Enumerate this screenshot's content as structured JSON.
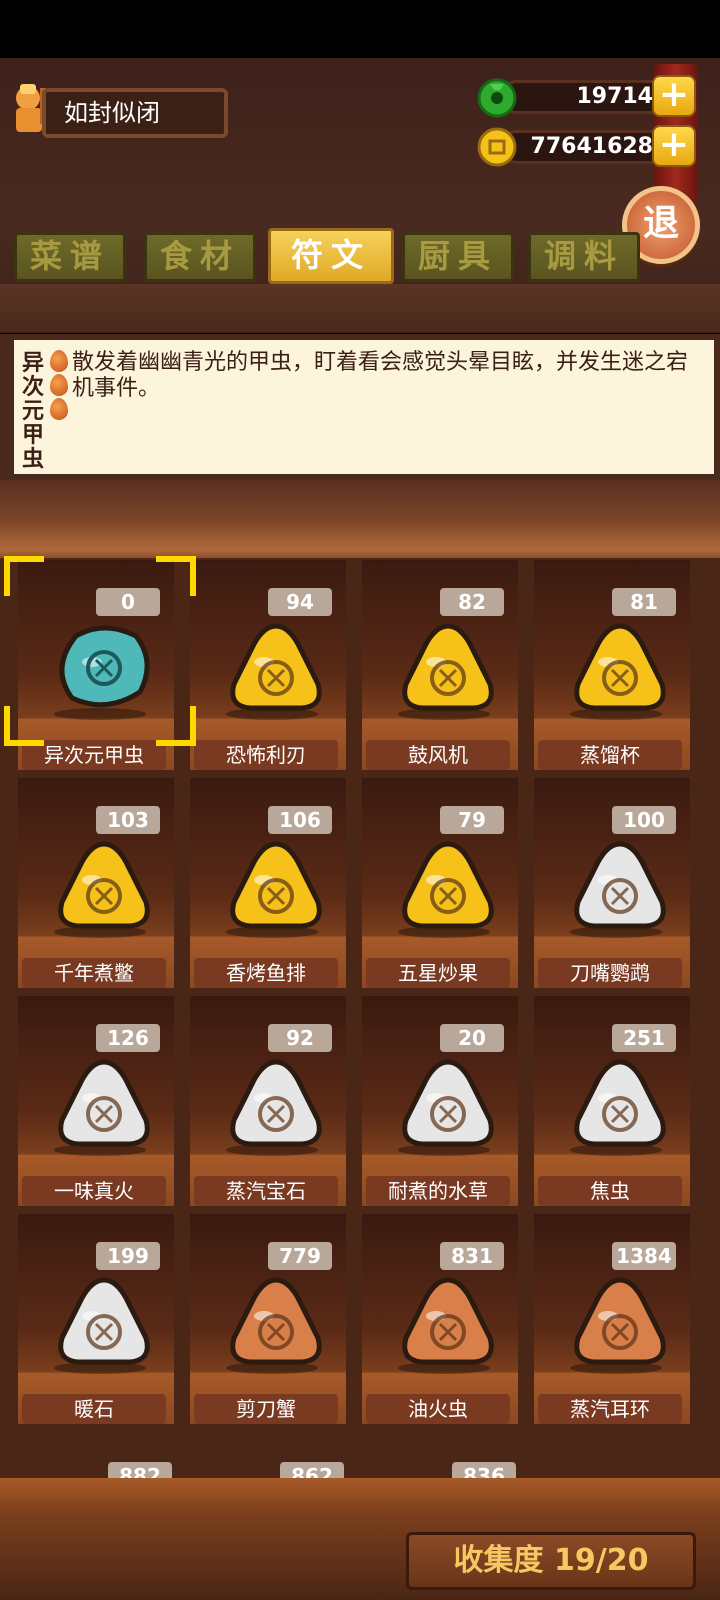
{
  "player": {
    "name": "如封似闭"
  },
  "currency": [
    {
      "icon": "jade-coin-icon",
      "value": "19714"
    },
    {
      "icon": "gold-coin-icon",
      "value": "77641628"
    }
  ],
  "plus_label": "+",
  "exit_label": "退",
  "tabs": [
    {
      "label": "菜谱",
      "active": false
    },
    {
      "label": "食材",
      "active": false
    },
    {
      "label": "符文",
      "active": true
    },
    {
      "label": "厨具",
      "active": false
    },
    {
      "label": "调料",
      "active": false
    }
  ],
  "selected": {
    "name": "异次元甲虫",
    "description": "散发着幽幽青光的甲虫，盯着看会感觉头晕目眩，并发生迷之宕机事件。"
  },
  "runes": [
    {
      "name": "异次元甲虫",
      "count": "0",
      "color": "#4fb8b8",
      "glyph": "beetle-glyph"
    },
    {
      "name": "恐怖利刃",
      "count": "94",
      "color": "#f6c21a",
      "glyph": "blade-glyph"
    },
    {
      "name": "鼓风机",
      "count": "82",
      "color": "#f6c21a",
      "glyph": "spiral-glyph"
    },
    {
      "name": "蒸馏杯",
      "count": "81",
      "color": "#f6c21a",
      "glyph": "cup-glyph"
    },
    {
      "name": "千年煮鳖",
      "count": "103",
      "color": "#f6c21a",
      "glyph": "turtle-glyph"
    },
    {
      "name": "香烤鱼排",
      "count": "106",
      "color": "#f6c21a",
      "glyph": "fish-glyph"
    },
    {
      "name": "五星炒果",
      "count": "79",
      "color": "#f6c21a",
      "glyph": "star-glyph"
    },
    {
      "name": "刀嘴鹦鹉",
      "count": "100",
      "color": "#e6e6e6",
      "glyph": "parrot-glyph"
    },
    {
      "name": "一味真火",
      "count": "126",
      "color": "#e6e6e6",
      "glyph": "leaf-glyph"
    },
    {
      "name": "蒸汽宝石",
      "count": "92",
      "color": "#e6e6e6",
      "glyph": "steam-glyph"
    },
    {
      "name": "耐煮的水草",
      "count": "20",
      "color": "#e6e6e6",
      "glyph": "weed-glyph"
    },
    {
      "name": "焦虫",
      "count": "251",
      "color": "#e6e6e6",
      "glyph": "bug-glyph"
    },
    {
      "name": "暖石",
      "count": "199",
      "color": "#e6e6e6",
      "glyph": "wave-glyph"
    },
    {
      "name": "剪刀蟹",
      "count": "779",
      "color": "#d9804a",
      "glyph": "crab-glyph"
    },
    {
      "name": "油火虫",
      "count": "831",
      "color": "#d9804a",
      "glyph": "firefly-glyph"
    },
    {
      "name": "蒸汽耳环",
      "count": "1384",
      "color": "#d9804a",
      "glyph": "earring-glyph"
    }
  ],
  "peek_counts": [
    "882",
    "862",
    "836"
  ],
  "collection": "收集度 19/20"
}
